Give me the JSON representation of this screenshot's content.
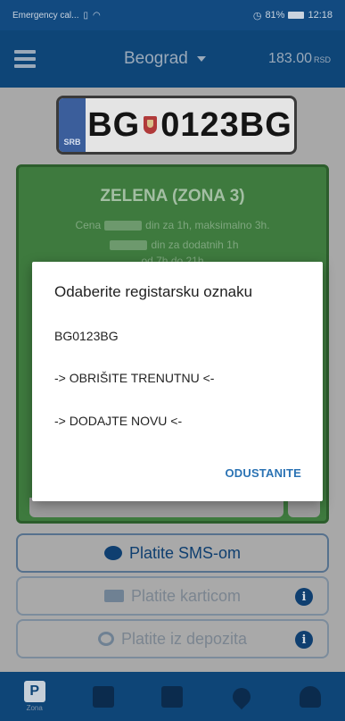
{
  "status_bar": {
    "left_text": "Emergency cal...",
    "battery": "81%",
    "time": "12:18"
  },
  "app_bar": {
    "city": "Beograd",
    "balance": "183.00",
    "currency": "RSD"
  },
  "plate": {
    "country_code": "SRB",
    "text_left": "BG",
    "text_right": "0123BG"
  },
  "zone": {
    "title": "ZELENA (ZONA 3)",
    "line1_pre": "Cena",
    "line1_post": "din za 1h, maksimalno 3h.",
    "line2_post": "din za dodatnih 1h",
    "line3": "od 7h do 21h"
  },
  "payment": {
    "sms_label": "Platite SMS-om",
    "card_label": "Platite karticom",
    "deposit_label": "Platite iz depozita",
    "info_glyph": "i"
  },
  "bottom_nav": {
    "zone_label": "Zona",
    "zone_glyph": "P"
  },
  "dialog": {
    "title": "Odaberite registarsku oznaku",
    "options": [
      "BG0123BG",
      "-> OBRIŠITE TRENUTNU <-",
      "-> DODAJTE NOVU <-"
    ],
    "cancel_label": "ODUSTANITE"
  },
  "colors": {
    "primary": "#0e4577",
    "zone_green": "#3e7a3e",
    "accent_link": "#2b73b4"
  }
}
